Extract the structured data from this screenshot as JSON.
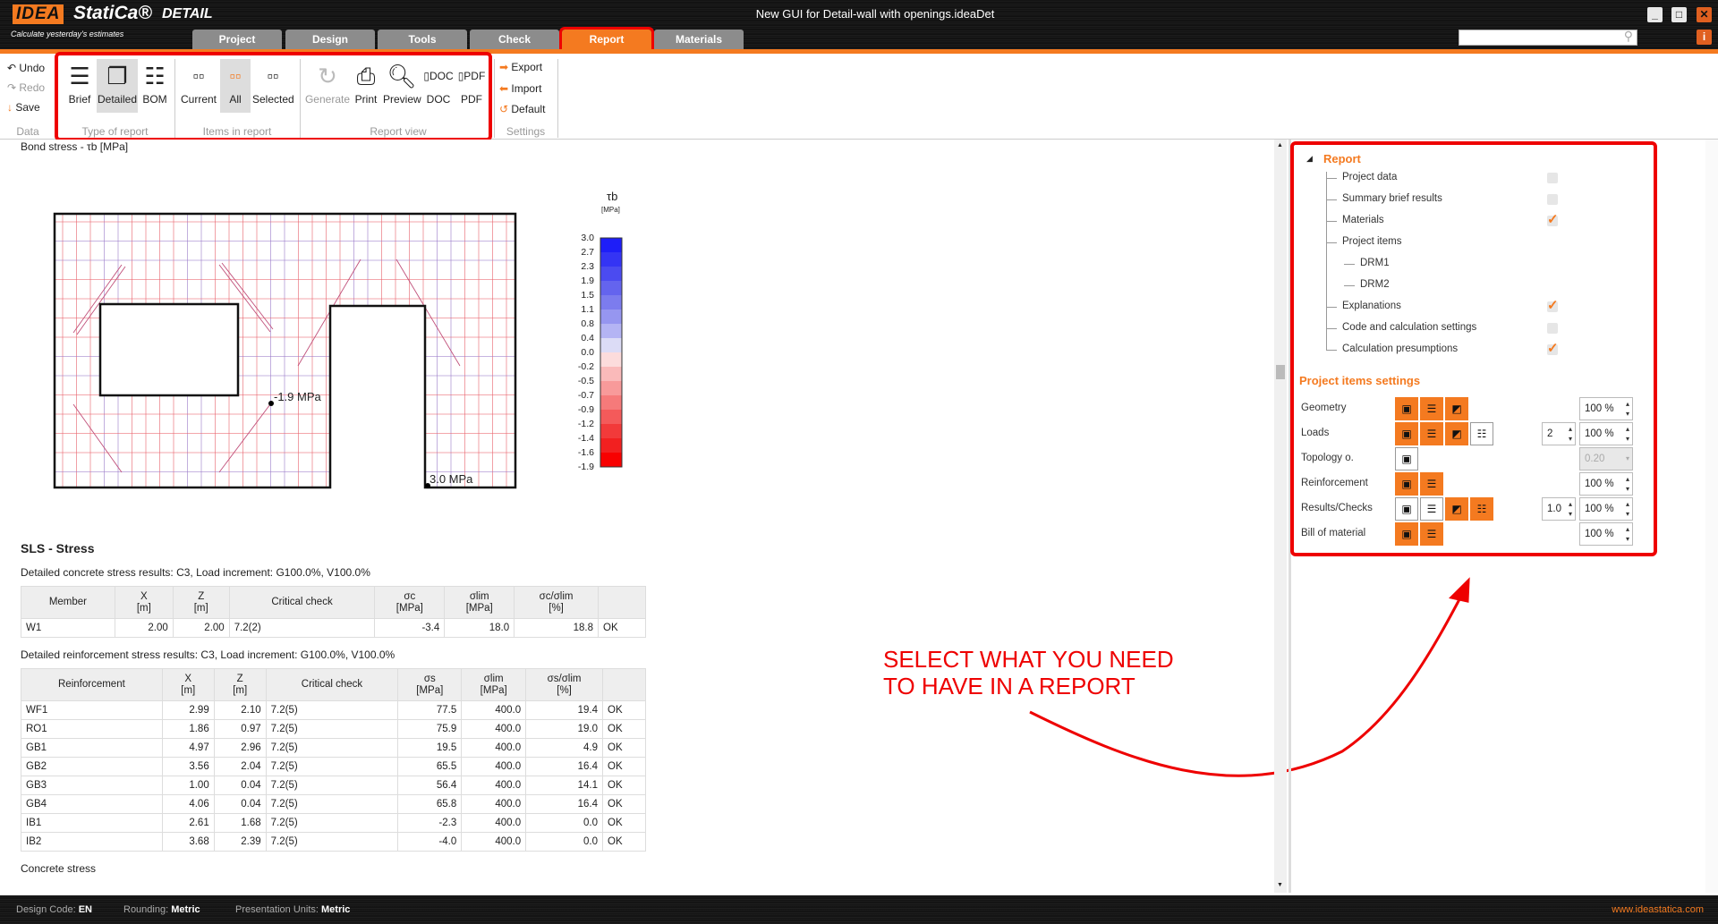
{
  "app": {
    "logo_idea": "IDEA",
    "logo_statica": "StatiCa®",
    "product": "DETAIL",
    "tagline": "Calculate yesterday's estimates",
    "title": "New GUI for Detail-wall with openings.ideaDet"
  },
  "tabs": [
    "Project",
    "Design",
    "Tools",
    "Check",
    "Report",
    "Materials"
  ],
  "active_tab": "Report",
  "search": {
    "placeholder": ""
  },
  "window": {
    "minimize": "_",
    "maximize": "□",
    "close": "✕",
    "info": "i"
  },
  "ribbon": {
    "data": {
      "undo": "Undo",
      "redo": "Redo",
      "save": "Save",
      "label": "Data"
    },
    "type_of_report": {
      "items": [
        "Brief",
        "Detailed",
        "BOM"
      ],
      "selected": "Detailed",
      "label": "Type of report"
    },
    "items_in_report": {
      "items": [
        "Current",
        "All",
        "Selected"
      ],
      "selected": "All",
      "label": "Items in report"
    },
    "report_view": {
      "items": [
        "Generate",
        "Print",
        "Preview",
        "DOC",
        "PDF"
      ],
      "label": "Report view"
    },
    "settings": {
      "export": "Export",
      "import": "Import",
      "default": "Default",
      "label": "Settings"
    }
  },
  "document": {
    "bond_title": "Bond stress - τb [MPa]",
    "colorbar": {
      "title": "τb",
      "unit": "[MPa]",
      "labels": [
        "3.0",
        "2.7",
        "2.3",
        "1.9",
        "1.5",
        "1.1",
        "0.8",
        "0.4",
        "0.0",
        "-0.2",
        "-0.5",
        "-0.7",
        "-0.9",
        "-1.2",
        "-1.4",
        "-1.6",
        "-1.9"
      ],
      "colors": [
        "#1e1ef8",
        "#3434f4",
        "#4b4bf0",
        "#6464ee",
        "#7c7cee",
        "#9696f0",
        "#b4b4f4",
        "#dcdcf6",
        "#fcdcdc",
        "#fababa",
        "#f89a9a",
        "#f67a7a",
        "#f45a5a",
        "#f23a3a",
        "#f22020",
        "#f80000"
      ]
    },
    "min_label": "-1.9 MPa",
    "max_label": "3.0 MPa",
    "sls_title": "SLS - Stress",
    "concrete_caption": "Detailed concrete stress results: C3, Load increment: G100.0%, V100.0%",
    "concrete_table": {
      "headers": [
        "Member",
        "X\n[m]",
        "Z\n[m]",
        "Critical check",
        "σc\n[MPa]",
        "σlim\n[MPa]",
        "σc/σlim\n[%]",
        ""
      ],
      "rows": [
        [
          "W1",
          "2.00",
          "2.00",
          "7.2(2)",
          "-3.4",
          "18.0",
          "18.8",
          "OK"
        ]
      ]
    },
    "reinf_caption": "Detailed reinforcement stress results: C3, Load increment: G100.0%, V100.0%",
    "reinf_table": {
      "headers": [
        "Reinforcement",
        "X\n[m]",
        "Z\n[m]",
        "Critical check",
        "σs\n[MPa]",
        "σlim\n[MPa]",
        "σs/σlim\n[%]",
        ""
      ],
      "rows": [
        [
          "WF1",
          "2.99",
          "2.10",
          "7.2(5)",
          "77.5",
          "400.0",
          "19.4",
          "OK"
        ],
        [
          "RO1",
          "1.86",
          "0.97",
          "7.2(5)",
          "75.9",
          "400.0",
          "19.0",
          "OK"
        ],
        [
          "GB1",
          "4.97",
          "2.96",
          "7.2(5)",
          "19.5",
          "400.0",
          "4.9",
          "OK"
        ],
        [
          "GB2",
          "3.56",
          "2.04",
          "7.2(5)",
          "65.5",
          "400.0",
          "16.4",
          "OK"
        ],
        [
          "GB3",
          "1.00",
          "0.04",
          "7.2(5)",
          "56.4",
          "400.0",
          "14.1",
          "OK"
        ],
        [
          "GB4",
          "4.06",
          "0.04",
          "7.2(5)",
          "65.8",
          "400.0",
          "16.4",
          "OK"
        ],
        [
          "IB1",
          "2.61",
          "1.68",
          "7.2(5)",
          "-2.3",
          "400.0",
          "0.0",
          "OK"
        ],
        [
          "IB2",
          "3.68",
          "2.39",
          "7.2(5)",
          "-4.0",
          "400.0",
          "0.0",
          "OK"
        ]
      ]
    },
    "concrete_stress": "Concrete stress"
  },
  "annotation": {
    "line1": "SELECT WHAT YOU NEED",
    "line2": "TO HAVE IN A REPORT"
  },
  "panel": {
    "report_title": "Report",
    "tree": [
      {
        "label": "Project data",
        "checked": false,
        "level": 1
      },
      {
        "label": "Summary brief results",
        "checked": false,
        "level": 1
      },
      {
        "label": "Materials",
        "checked": true,
        "level": 1
      },
      {
        "label": "Project items",
        "level": 1
      },
      {
        "label": "DRM1",
        "level": 2
      },
      {
        "label": "DRM2",
        "level": 2
      },
      {
        "label": "Explanations",
        "checked": true,
        "level": 1
      },
      {
        "label": "Code and calculation settings",
        "checked": false,
        "level": 1
      },
      {
        "label": "Calculation presumptions",
        "checked": true,
        "level": 1
      }
    ],
    "settings_title": "Project items settings",
    "settings": [
      {
        "label": "Geometry",
        "buttons": [
          true,
          true,
          true
        ],
        "percent": "100 %"
      },
      {
        "label": "Loads",
        "buttons": [
          true,
          true,
          true,
          false
        ],
        "count": "2",
        "percent": "100 %"
      },
      {
        "label": "Topology o.",
        "buttons": [
          false
        ],
        "dropdown": "0.20"
      },
      {
        "label": "Reinforcement",
        "buttons": [
          true,
          true
        ],
        "percent": "100 %"
      },
      {
        "label": "Results/Checks",
        "buttons": [
          false,
          false,
          true,
          true
        ],
        "count": "1.0",
        "percent": "100 %"
      },
      {
        "label": "Bill of material",
        "buttons": [
          true,
          true
        ],
        "percent": "100 %"
      }
    ]
  },
  "statusbar": {
    "design_code_label": "Design Code:",
    "design_code": "EN",
    "rounding_label": "Rounding:",
    "rounding": "Metric",
    "units_label": "Presentation Units:",
    "units": "Metric",
    "website": "www.ideastatica.com"
  },
  "colors": {
    "accent": "#f47a20",
    "highlight": "#ee0000"
  }
}
